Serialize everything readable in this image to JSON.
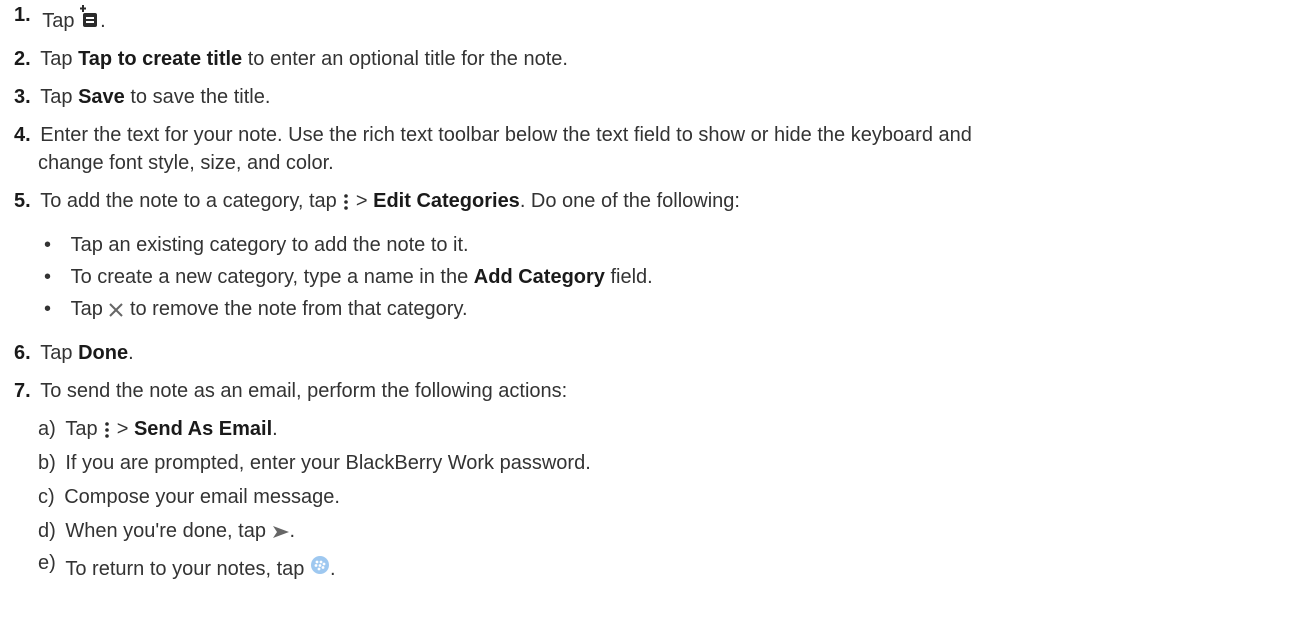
{
  "steps": [
    {
      "num": "1.",
      "pre": "Tap ",
      "post": ".",
      "icon": "new-note-icon"
    },
    {
      "num": "2.",
      "pre": "Tap ",
      "bold": "Tap to create title",
      "post": " to enter an optional title for the note."
    },
    {
      "num": "3.",
      "pre": "Tap ",
      "bold": "Save",
      "post": " to save the title."
    },
    {
      "num": "4.",
      "line1": "Enter the text for your note. Use the rich text toolbar below the text field to show or hide the keyboard and",
      "line2": "change font style, size, and color."
    },
    {
      "num": "5.",
      "pre": "To add the note to a category, tap ",
      "mid": " > ",
      "bold": "Edit Categories",
      "post": ". Do one of the following:",
      "icon": "overflow-menu-icon"
    },
    {
      "num": "6.",
      "pre": "Tap ",
      "bold": "Done",
      "post": "."
    },
    {
      "num": "7.",
      "text": "To send the note as an email, perform the following actions:"
    }
  ],
  "bullets": [
    {
      "text": "Tap an existing category to add the note to it."
    },
    {
      "pre": "To create a new category, type a name in the ",
      "bold": "Add Category",
      "post": " field."
    },
    {
      "pre": "Tap ",
      "post": " to remove the note from that category.",
      "icon": "close-icon"
    }
  ],
  "bullet_char": "•",
  "substeps": [
    {
      "label": "a)",
      "pre": "Tap ",
      "mid": " > ",
      "bold": "Send As Email",
      "post": ".",
      "icon": "overflow-menu-icon"
    },
    {
      "label": "b)",
      "text": "If you are prompted, enter your BlackBerry Work password."
    },
    {
      "label": "c)",
      "text": "Compose your email message."
    },
    {
      "label": "d)",
      "pre": "When you're done, tap ",
      "post": ".",
      "icon": "send-icon"
    },
    {
      "label": "e)",
      "pre": "To return to your notes, tap ",
      "post": ".",
      "icon": "blackberry-logo-icon"
    }
  ],
  "colors": {
    "text": "#333333",
    "icon_dark": "#2b2b2b",
    "icon_gray": "#666666",
    "icon_blue": "#9ec8f0"
  }
}
